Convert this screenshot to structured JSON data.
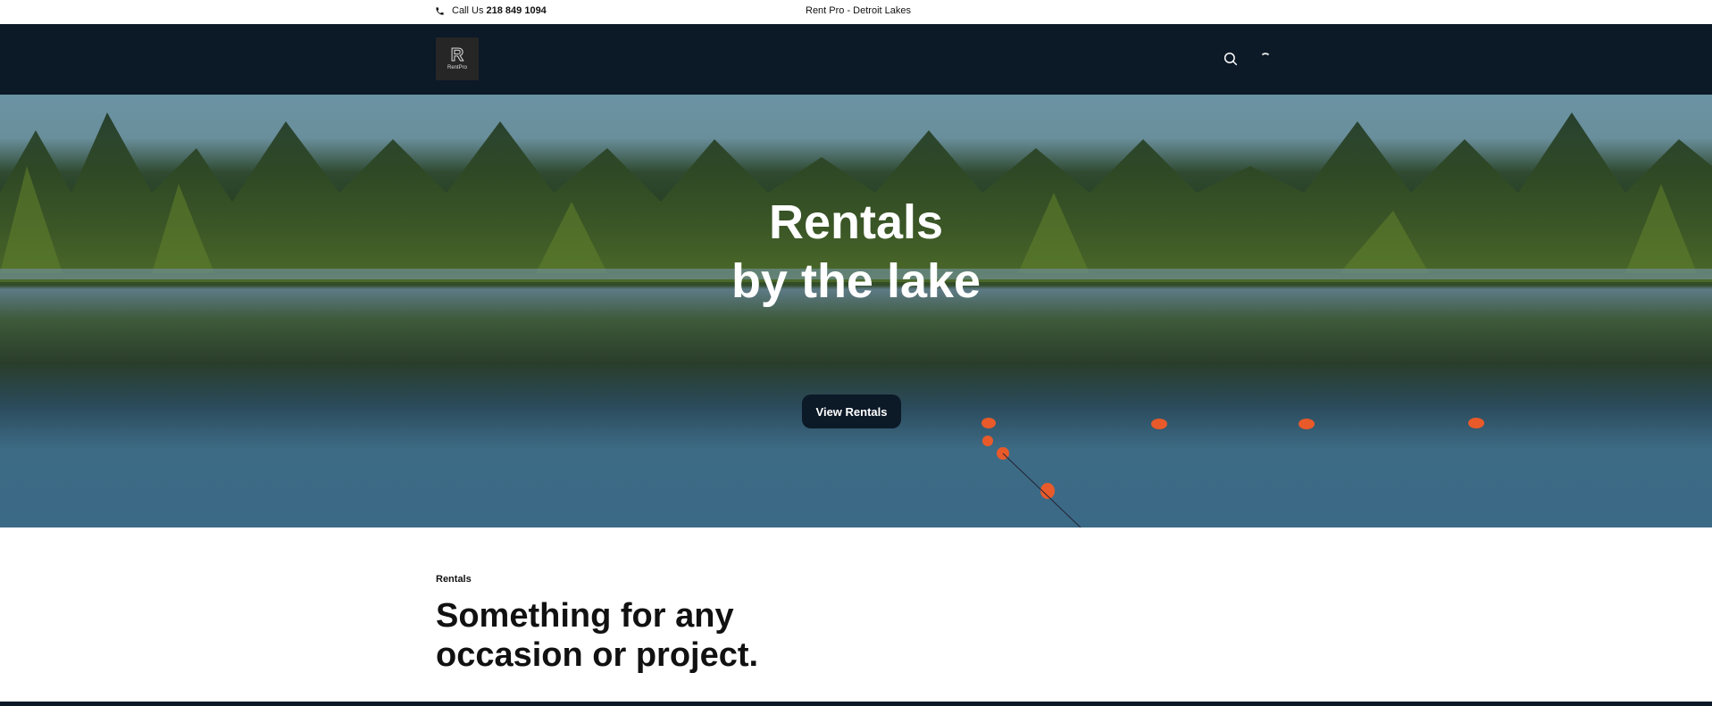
{
  "topbar": {
    "call_prefix": "Call Us",
    "phone": "218 849 1094",
    "brand": "Rent Pro - Detroit Lakes"
  },
  "nav": {
    "logo_text": "RentPro",
    "logo_letter": "R"
  },
  "hero": {
    "title_line1": "Rentals",
    "title_line2": "by the lake",
    "cta": "View Rentals"
  },
  "section": {
    "label": "Rentals",
    "title_line1": "Something for any",
    "title_line2": "occasion or project."
  },
  "colors": {
    "navy": "#0c1927"
  }
}
